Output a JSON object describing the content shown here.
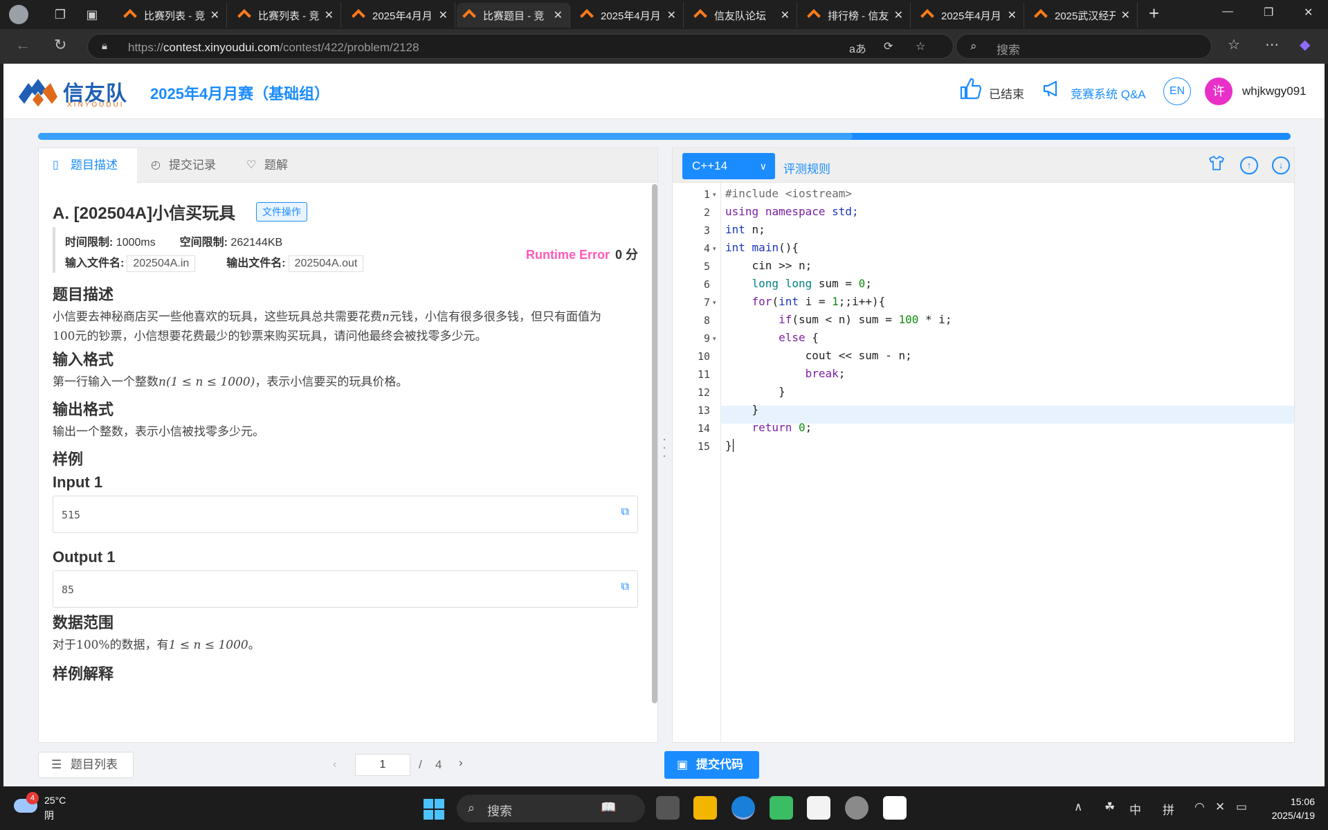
{
  "browser": {
    "tabs": [
      {
        "title": "比赛列表 - 竞"
      },
      {
        "title": "比赛列表 - 竞"
      },
      {
        "title": "2025年4月月"
      },
      {
        "title": "比赛题目 - 竞"
      },
      {
        "title": "2025年4月月"
      },
      {
        "title": "信友队论坛"
      },
      {
        "title": "排行榜 - 信友"
      },
      {
        "title": "2025年4月月"
      },
      {
        "title": "2025武汉经开"
      }
    ],
    "active_tab_index": 3,
    "url_prefix": "https://",
    "url_host": "contest.xinyoudui.com",
    "url_path": "/contest/422/problem/2128",
    "search_placeholder": "搜索"
  },
  "header": {
    "logo_text": "信友队",
    "logo_sub": "XINYOUDUI",
    "contest_title": "2025年4月月赛（基础组）",
    "status": "已结束",
    "qa_link": "竞赛系统 Q&A",
    "lang_toggle": "EN",
    "avatar_char": "许",
    "username": "whjkwgy091"
  },
  "progress": {
    "fraction": 0.65
  },
  "left_tabs": [
    {
      "label": "题目描述",
      "icon": "document-icon"
    },
    {
      "label": "提交记录",
      "icon": "history-icon"
    },
    {
      "label": "题解",
      "icon": "bulb-icon"
    }
  ],
  "problem": {
    "title": "A.  [202504A]小信买玩具",
    "file_badge": "文件操作",
    "time_limit_label": "时间限制:",
    "time_limit": "1000ms",
    "mem_limit_label": "空间限制:",
    "mem_limit": "262144KB",
    "input_file_label": "输入文件名:",
    "input_file": "202504A.in",
    "output_file_label": "输出文件名:",
    "output_file": "202504A.out",
    "result_status": "Runtime Error",
    "result_score": "0 分",
    "desc_heading": "题目描述",
    "desc_line1_a": "小信要去神秘商店买一些他喜欢的玩具，这些玩具总共需要花费",
    "desc_var": "n",
    "desc_line1_b": "元钱，小信有很多很多钱，但只有面值为",
    "desc_line2": "元的钞票，小信想要花费最少的钞票来购买玩具，请问他最终会被找零多少元。",
    "desc_num": "100",
    "input_heading": "输入格式",
    "input_text_a": "第一行输入一个整数",
    "input_math": "n(1 ≤ n ≤ 1000)",
    "input_text_b": "，表示小信要买的玩具价格。",
    "output_heading": "输出格式",
    "output_text": "输出一个整数，表示小信被找零多少元。",
    "sample_heading": "样例",
    "input1_label": "Input 1",
    "input1_value": "515",
    "output1_label": "Output 1",
    "output1_value": "85",
    "range_heading": "数据范围",
    "range_text_a": "对于",
    "range_pct": "100%",
    "range_text_b": "的数据，有",
    "range_math": "1 ≤ n ≤ 1000",
    "range_text_c": "。",
    "explain_heading": "样例解释"
  },
  "bottom": {
    "problem_list": "题目列表",
    "page_current": "1",
    "page_sep": "/",
    "page_total": "4",
    "submit": "提交代码"
  },
  "editor": {
    "language": "C++14",
    "rules_link": "评测规则",
    "lines": [
      {
        "n": "1",
        "fold": true
      },
      {
        "n": "2"
      },
      {
        "n": "3"
      },
      {
        "n": "4",
        "fold": true
      },
      {
        "n": "5"
      },
      {
        "n": "6"
      },
      {
        "n": "7",
        "fold": true
      },
      {
        "n": "8"
      },
      {
        "n": "9",
        "fold": true
      },
      {
        "n": "10"
      },
      {
        "n": "11"
      },
      {
        "n": "12"
      },
      {
        "n": "13"
      },
      {
        "n": "14"
      },
      {
        "n": "15"
      }
    ],
    "code": {
      "l1": "#include <iostream>",
      "l2_a": "using",
      "l2_b": "namespace",
      "l2_c": "std;",
      "l3_a": "int",
      "l3_b": " n;",
      "l4_a": "int",
      "l4_b": "main",
      "l4_c": "(){",
      "l5": "    cin >> n;",
      "l6_a": "long long",
      "l6_b": " sum = ",
      "l6_c": "0",
      "l6_d": ";",
      "l7_a": "for",
      "l7_b": "(",
      "l7_c": "int",
      "l7_d": " i = ",
      "l7_e": "1",
      "l7_f": ";;i++){",
      "l8_a": "if",
      "l8_b": "(sum < n) sum = ",
      "l8_c": "100",
      "l8_d": " * i;",
      "l9_a": "else",
      "l9_b": " {",
      "l10": "            cout << sum - n;",
      "l11_a": "break",
      "l11_b": ";",
      "l12": "        }",
      "l13": "    }",
      "l14_a": "return",
      "l14_b": " 0",
      "l14_c": ";",
      "l15": "}"
    }
  },
  "taskbar": {
    "weather_badge": "4",
    "temperature": "25°C",
    "condition": "阴",
    "search": "搜索",
    "ime_lang": "中",
    "ime_mode": "拼",
    "time": "15:06",
    "date": "2025/4/19"
  },
  "colors": {
    "accent": "#1a8cff",
    "runtime_error": "#ff59b8",
    "avatar_bg": "#e830c8"
  }
}
